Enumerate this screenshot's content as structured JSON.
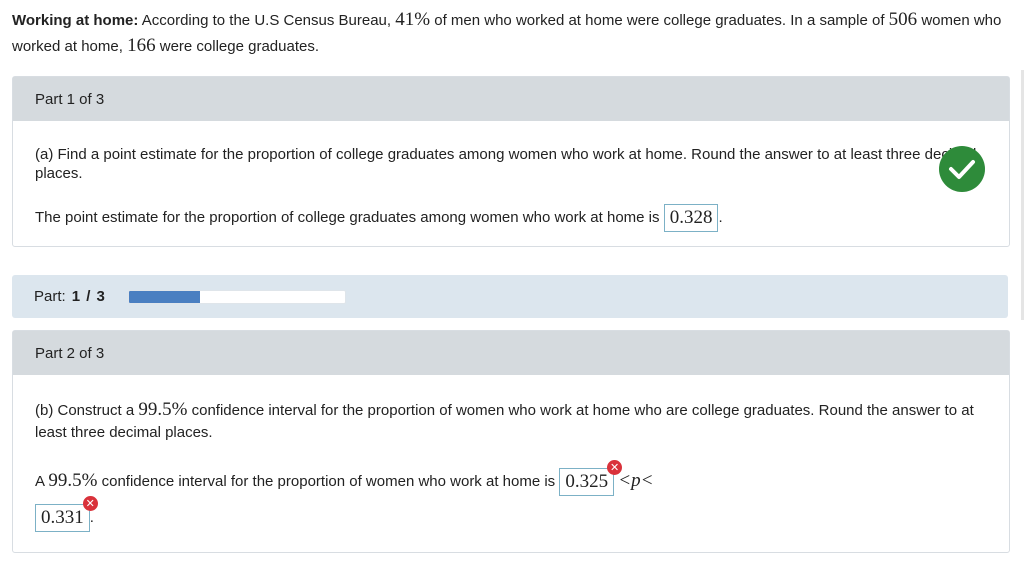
{
  "problem": {
    "title": "Working at home:",
    "text_a": "According to the U.S Census Bureau,",
    "pct_men": "41%",
    "text_b": "of men who worked at home were college graduates. In a sample of",
    "sample_size": "506",
    "text_c": "women who worked at home,",
    "grads": "166",
    "text_d": "were college graduates."
  },
  "part1": {
    "header": "Part 1 of 3",
    "question": "(a) Find a point estimate for the proportion of college graduates among women who work at home. Round the answer to at least three decimal places.",
    "answer_prefix": "The point estimate for the proportion of college graduates among women who work at home is",
    "answer_value": "0.328",
    "answer_suffix": ".",
    "status_icon": "check-icon"
  },
  "progress": {
    "label": "Part:",
    "value_text": "1 / 3",
    "fraction": 0.33
  },
  "part2": {
    "header": "Part 2 of 3",
    "q_prefix": "(b) Construct a",
    "q_conf": "99.5%",
    "q_suffix": "confidence interval for the proportion of women who work at home who are college graduates. Round the answer to at least three decimal places.",
    "a_prefix": "A",
    "a_conf": "99.5%",
    "a_text": "confidence interval for the proportion of women who work at home is",
    "lower": "0.325",
    "ineq": "<p<",
    "upper": "0.331",
    "end": ".",
    "error_icon": "error-icon"
  },
  "colors": {
    "check": "#2e8b3a",
    "error": "#d9323b",
    "progress_fill": "#4a7fc1"
  }
}
